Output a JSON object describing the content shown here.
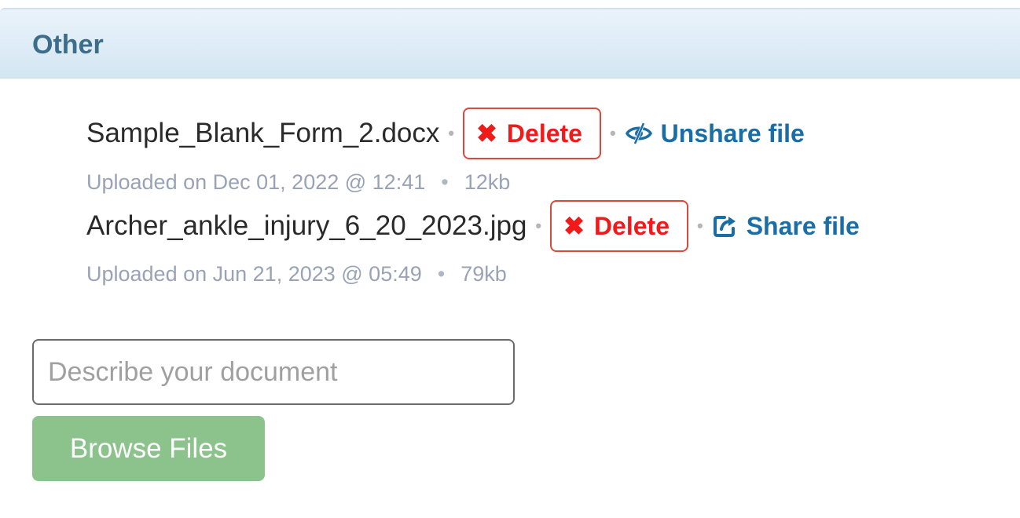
{
  "section": {
    "title": "Other"
  },
  "files": [
    {
      "name": "Sample_Blank_Form_2.docx",
      "delete_label": "Delete",
      "share_label": "Unshare file",
      "share_icon": "eye-slash-icon",
      "uploaded": "Uploaded on Dec 01, 2022 @ 12:41",
      "size": "12kb"
    },
    {
      "name": "Archer_ankle_injury_6_20_2023.jpg",
      "delete_label": "Delete",
      "share_label": "Share file",
      "share_icon": "share-icon",
      "uploaded": "Uploaded on Jun 21, 2023 @ 05:49",
      "size": "79kb"
    }
  ],
  "separator": "•",
  "upload": {
    "description_placeholder": "Describe your document",
    "description_value": "",
    "browse_label": "Browse Files"
  },
  "colors": {
    "header_text": "#3e6d8a",
    "delete": "#f01a1a",
    "delete_border": "#d94a3c",
    "link": "#1b6ea5",
    "meta_text": "#9aa3b5",
    "browse_button": "#8cc38c"
  }
}
